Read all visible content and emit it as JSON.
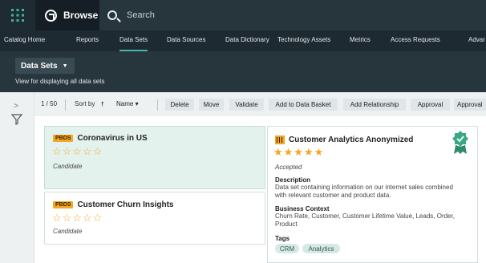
{
  "topbar": {
    "browse_label": "Browse",
    "search_placeholder": "Search"
  },
  "nav": {
    "items": [
      {
        "label": "Catalog Home"
      },
      {
        "label": "Reports"
      },
      {
        "label": "Data Sets",
        "active": true
      },
      {
        "label": "Data Sources"
      },
      {
        "label": "Data Dictionary"
      },
      {
        "label": "Technology Assets"
      },
      {
        "label": "Metrics"
      },
      {
        "label": "Access Requests"
      },
      {
        "label": "Advar"
      }
    ]
  },
  "header": {
    "dropdown_label": "Data Sets",
    "description": "View for displaying all data sets"
  },
  "toolbar": {
    "count": "1 / 50",
    "sort_label": "Sort by",
    "sort_field": "Name",
    "buttons": [
      "Delete",
      "Move",
      "Validate",
      "Add to Data Basket",
      "Add Relationship",
      "Approval",
      "Approval"
    ]
  },
  "cards": [
    {
      "badge": "PBDS",
      "title": "Coronavirus in US",
      "stars": "☆☆☆☆☆",
      "status": "Candidate"
    },
    {
      "badge": "PBDS",
      "title": "Customer Churn Insights",
      "stars": "☆☆☆☆☆",
      "status": "Candidate"
    },
    {
      "title": "Customer Analytics Anonymized",
      "stars": "★★★★★",
      "status": "Accepted",
      "description_label": "Description",
      "description_lines": [
        "Data set containing information on our internet sales combined",
        "with relevant customer and product data."
      ],
      "context_label": "Business Context",
      "context_lines": [
        "Churn Rate, Customer, Customer Lifetime Value, Leads, Order,",
        "Product"
      ],
      "tags_label": "Tags",
      "tags": [
        "CRM",
        "Analytics"
      ]
    }
  ],
  "colors": {
    "accent": "#44b7a9",
    "badge": "#f5a623",
    "topbar": "#27353d"
  }
}
